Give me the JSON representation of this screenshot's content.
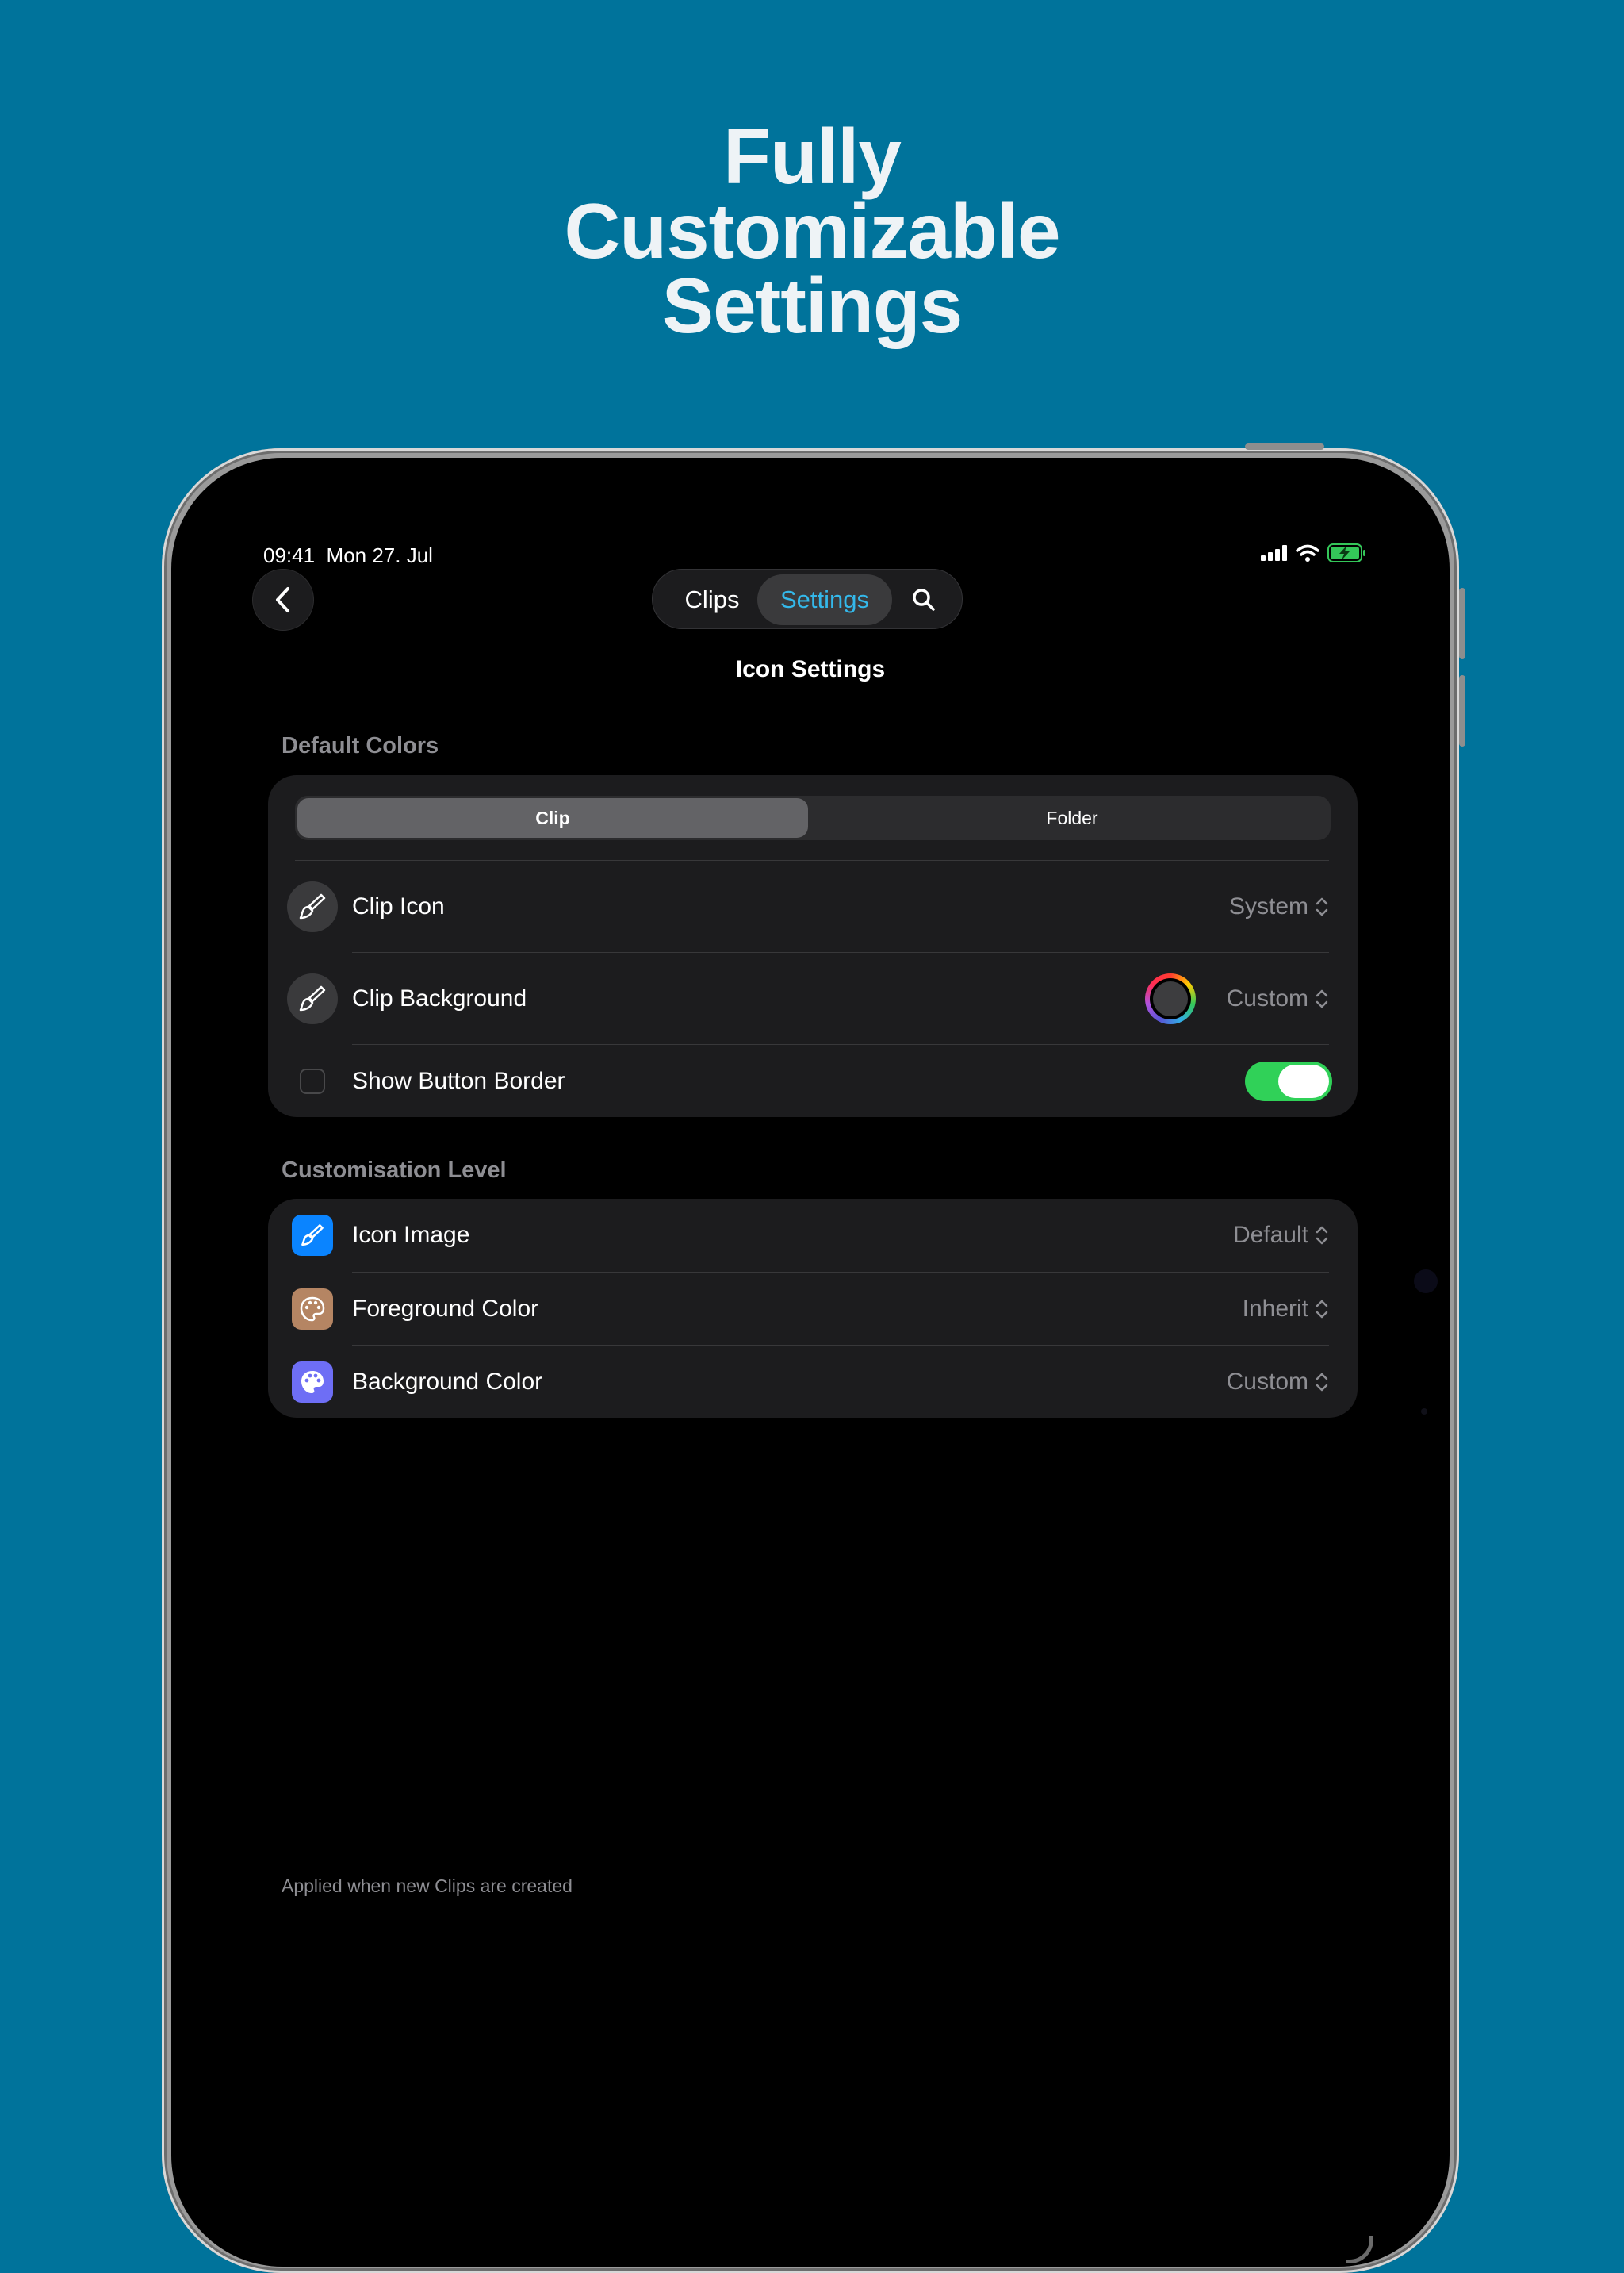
{
  "headline": {
    "line1": "Fully",
    "line2": "Customizable",
    "line3": "Settings"
  },
  "status_bar": {
    "time": "09:41",
    "date": "Mon 27. Jul"
  },
  "nav": {
    "tabs": {
      "clips": "Clips",
      "settings": "Settings"
    },
    "selected_tab": "Settings"
  },
  "page_title": "Icon Settings",
  "default_colors": {
    "header": "Default Colors",
    "segments": {
      "clip": "Clip",
      "folder": "Folder"
    },
    "selected_segment": "Clip",
    "rows": {
      "clip_icon": {
        "label": "Clip Icon",
        "value": "System"
      },
      "clip_background": {
        "label": "Clip Background",
        "value": "Custom"
      },
      "show_button_border": {
        "label": "Show Button Border",
        "enabled": true
      }
    }
  },
  "customisation_level": {
    "header": "Customisation Level",
    "rows": {
      "icon_image": {
        "label": "Icon Image",
        "value": "Default"
      },
      "foreground_color": {
        "label": "Foreground Color",
        "value": "Inherit"
      },
      "background_color": {
        "label": "Background Color",
        "value": "Custom"
      }
    },
    "footer": "Applied when new Clips are created"
  },
  "colors": {
    "page_background": "#00739b",
    "accent": "#34b8ea",
    "toggle_on": "#30d158",
    "icon_image_tile": "#0a84ff",
    "foreground_color_tile": "#b58563",
    "background_color_tile": "#6e6ef5"
  },
  "icons": {
    "back": "chevron-left-icon",
    "search": "magnifying-glass-icon",
    "clip_icon": "paintbrush-icon",
    "clip_background": "paintbrush-icon",
    "icon_image": "paintbrush-icon",
    "foreground_color": "palette-icon",
    "background_color": "palette-icon",
    "value_menu": "chevron-up-down-icon"
  }
}
